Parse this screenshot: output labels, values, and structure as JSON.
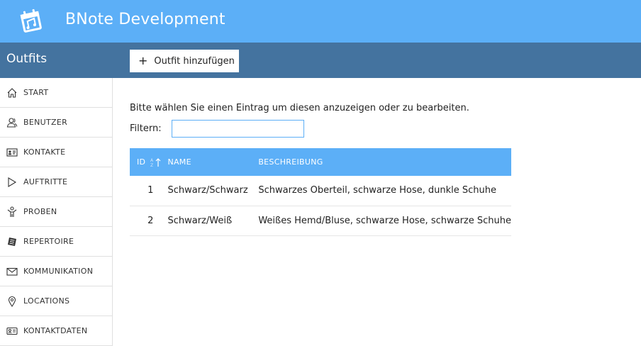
{
  "header": {
    "app_title": "BNote Development",
    "logo_icon": "calendar-music-icon"
  },
  "subheader": {
    "section_title": "Outfits",
    "add_button_label": "Outfit hinzufügen"
  },
  "sidebar": {
    "items": [
      {
        "label": "START",
        "icon": "home-icon"
      },
      {
        "label": "BENUTZER",
        "icon": "users-icon"
      },
      {
        "label": "KONTAKTE",
        "icon": "contact-card-icon"
      },
      {
        "label": "AUFTRITTE",
        "icon": "play-icon"
      },
      {
        "label": "PROBEN",
        "icon": "conductor-icon"
      },
      {
        "label": "REPERTOIRE",
        "icon": "sheet-music-icon"
      },
      {
        "label": "KOMMUNIKATION",
        "icon": "mail-icon"
      },
      {
        "label": "LOCATIONS",
        "icon": "location-pin-icon"
      },
      {
        "label": "KONTAKTDATEN",
        "icon": "id-card-icon"
      }
    ]
  },
  "main": {
    "info_text": "Bitte wählen Sie einen Eintrag um diesen anzuzeigen oder zu bearbeiten.",
    "filter_label": "Filtern:",
    "filter_value": "",
    "table": {
      "columns": [
        "ID",
        "NAME",
        "BESCHREIBUNG"
      ],
      "rows": [
        {
          "id": "1",
          "name": "Schwarz/Schwarz",
          "description": "Schwarzes Oberteil, schwarze Hose, dunkle Schuhe"
        },
        {
          "id": "2",
          "name": "Schwarz/Weiß",
          "description": "Weißes Hemd/Bluse, schwarze Hose, schwarze Schuhe"
        }
      ]
    }
  },
  "colors": {
    "topbar": "#5caff7",
    "subbar": "#44739f",
    "table_header": "#5caff7"
  }
}
